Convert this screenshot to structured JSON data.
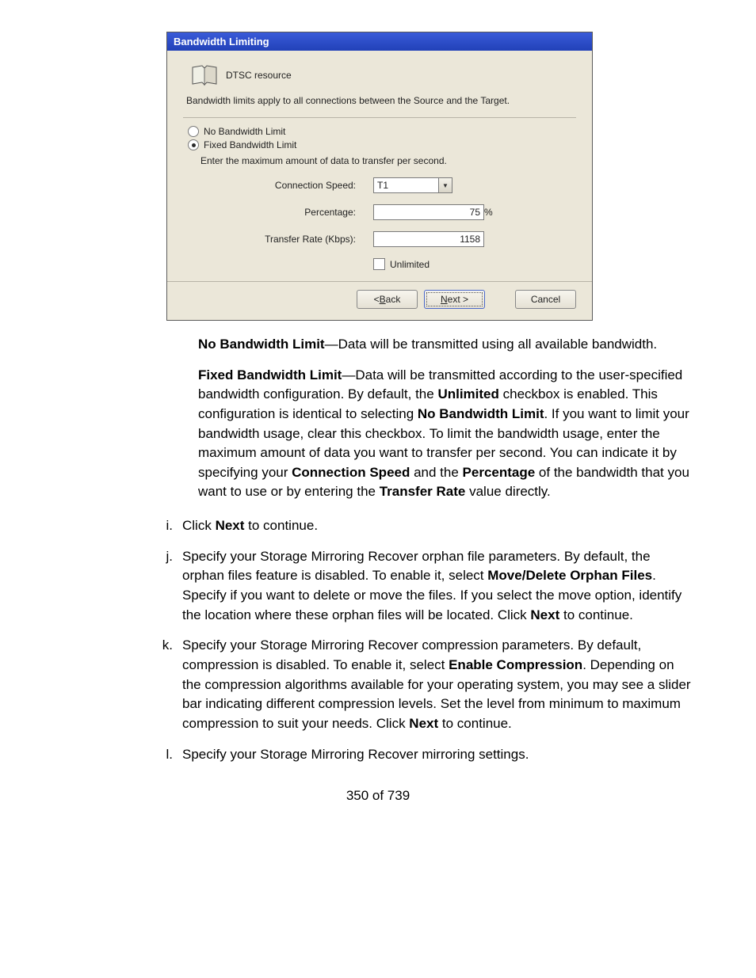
{
  "dialog": {
    "title": "Bandwidth Limiting",
    "resource": "DTSC resource",
    "description": "Bandwidth limits apply to all connections between the Source and the Target.",
    "radio_no_limit": "No Bandwidth Limit",
    "radio_fixed_limit": "Fixed Bandwidth Limit",
    "enter_max": "Enter the maximum amount of data to transfer per second.",
    "label_conn_speed": "Connection Speed:",
    "value_conn_speed": "T1",
    "label_percentage": "Percentage:",
    "value_percentage": "75",
    "percent_symbol": "%",
    "label_transfer_rate": "Transfer Rate (Kbps):",
    "value_transfer_rate": "1158",
    "chk_unlimited": "Unlimited",
    "btn_back": "< Back",
    "btn_next": "Next >",
    "btn_cancel": "Cancel"
  },
  "doc": {
    "p1_b1": "No Bandwidth Limit",
    "p1_rest": "—Data will be transmitted using all available bandwidth.",
    "p2_b1": "Fixed Bandwidth Limit",
    "p2_seg1": "—Data will be transmitted according to the user-specified bandwidth configuration. By default, the ",
    "p2_b2": "Unlimited",
    "p2_seg2": " checkbox is enabled. This configuration is identical to selecting ",
    "p2_b3": "No Bandwidth Limit",
    "p2_seg3": ". If you want to limit your bandwidth usage, clear this checkbox. To limit the bandwidth usage, enter the maximum amount of data you want to transfer per second. You can indicate it by specifying your ",
    "p2_b4": "Connection Speed",
    "p2_seg4": " and the ",
    "p2_b5": "Percentage",
    "p2_seg5": " of the bandwidth that you want to use or by entering the ",
    "p2_b6": "Transfer Rate",
    "p2_seg6": " value directly.",
    "li_i_marker": "i.",
    "li_i_seg1": "Click ",
    "li_i_b1": "Next",
    "li_i_seg2": " to continue.",
    "li_j_marker": "j.",
    "li_j_seg1": "Specify your Storage Mirroring Recover orphan file parameters. By default, the orphan files feature is disabled. To enable it, select ",
    "li_j_b1": "Move/Delete Orphan Files",
    "li_j_seg2": ". Specify if you want to delete or move the files. If you select the move option, identify the location where these orphan files will be located. Click ",
    "li_j_b2": "Next",
    "li_j_seg3": " to continue.",
    "li_k_marker": "k.",
    "li_k_seg1": "Specify your Storage Mirroring Recover compression parameters. By default, compression is disabled. To enable it, select ",
    "li_k_b1": "Enable Compression",
    "li_k_seg2": ". Depending on the compression algorithms available for your operating system, you may see a slider bar indicating different compression levels. Set the level from minimum to maximum compression to suit your needs. Click ",
    "li_k_b2": "Next",
    "li_k_seg3": " to continue.",
    "li_l_marker": "l.",
    "li_l_seg1": "Specify your Storage Mirroring Recover mirroring settings.",
    "page_num": "350 of 739"
  }
}
